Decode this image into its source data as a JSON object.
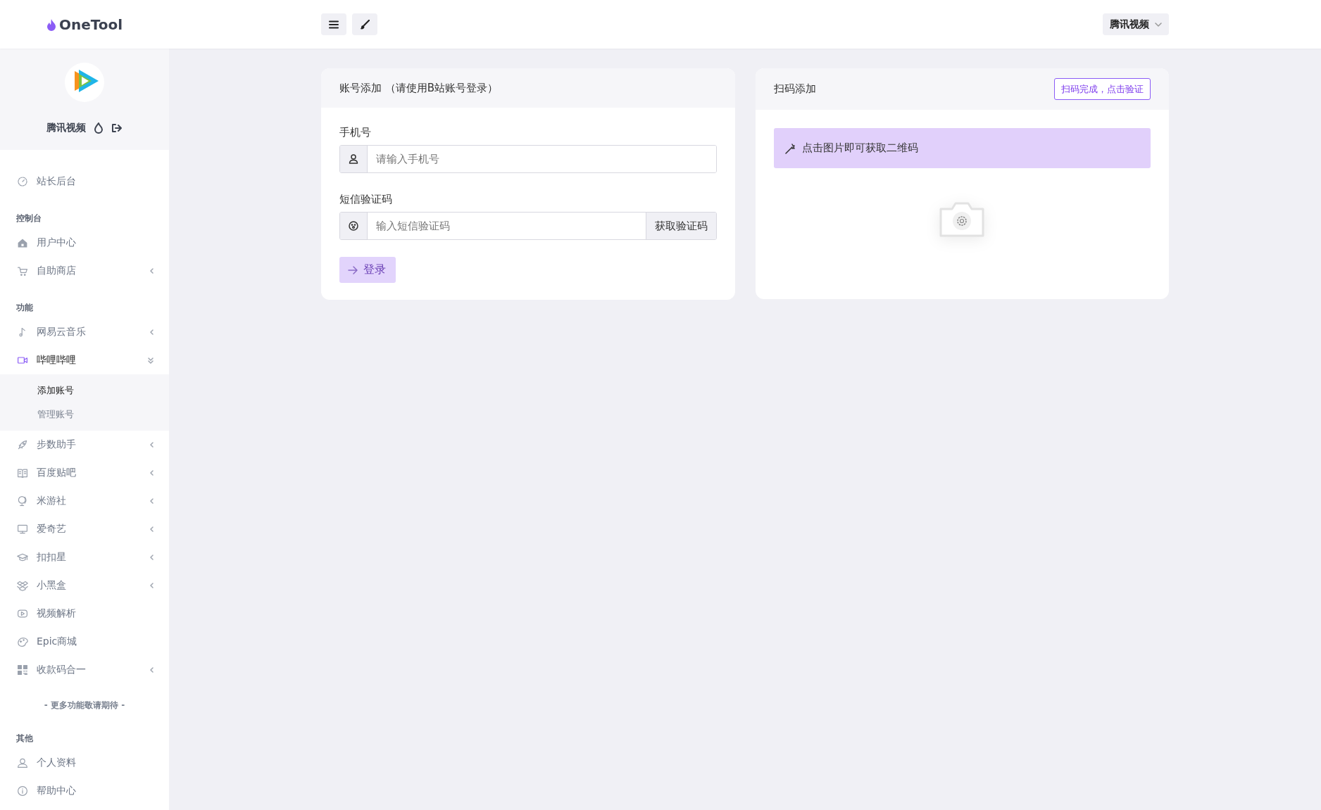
{
  "header": {
    "logo": "OneTool",
    "tool_buttons": [
      {
        "kind": "menu"
      },
      {
        "kind": "brush"
      }
    ],
    "site_switch": "腾讯视频"
  },
  "sidebar": {
    "profile": {
      "name": "腾讯视频"
    },
    "menu": [
      {
        "kind": "link",
        "label": "站长后台",
        "has_submenu": false
      },
      {
        "kind": "heading",
        "label": "控制台"
      },
      {
        "kind": "link",
        "label": "用户中心",
        "has_submenu": false
      },
      {
        "kind": "link",
        "label": "自助商店",
        "has_submenu": true,
        "expanded": false
      },
      {
        "kind": "heading",
        "label": "功能"
      },
      {
        "kind": "link",
        "label": "网易云音乐",
        "has_submenu": true,
        "expanded": false
      },
      {
        "kind": "link",
        "label": "哔哩哔哩",
        "has_submenu": true,
        "expanded": true,
        "children": [
          {
            "label": "添加账号",
            "selected": true
          },
          {
            "label": "管理账号",
            "selected": false
          }
        ]
      },
      {
        "kind": "link",
        "label": "步数助手",
        "has_submenu": true,
        "expanded": false
      },
      {
        "kind": "link",
        "label": "百度贴吧",
        "has_submenu": true,
        "expanded": false
      },
      {
        "kind": "link",
        "label": "米游社",
        "has_submenu": true,
        "expanded": false
      },
      {
        "kind": "link",
        "label": "爱奇艺",
        "has_submenu": true,
        "expanded": false
      },
      {
        "kind": "link",
        "label": "扣扣星",
        "has_submenu": true,
        "expanded": false
      },
      {
        "kind": "link",
        "label": "小黑盒",
        "has_submenu": true,
        "expanded": false
      },
      {
        "kind": "link",
        "label": "视频解析",
        "has_submenu": false
      },
      {
        "kind": "link",
        "label": "Epic商城",
        "has_submenu": false
      },
      {
        "kind": "link",
        "label": "收款码合一",
        "has_submenu": true,
        "expanded": false
      },
      {
        "kind": "note",
        "label": "- 更多功能敬请期待 -"
      },
      {
        "kind": "heading",
        "label": "其他"
      },
      {
        "kind": "link",
        "label": "个人资料",
        "has_submenu": false
      },
      {
        "kind": "link",
        "label": "帮助中心",
        "has_submenu": false
      }
    ]
  },
  "account_card": {
    "title": "账号添加 （请使用B站账号登录）",
    "fields": [
      {
        "label": "手机号",
        "placeholder": "请输入手机号"
      },
      {
        "label": "短信验证码",
        "placeholder": "输入短信验证码",
        "action": "获取验证码"
      }
    ],
    "submit": "登录"
  },
  "qr_card": {
    "title": "扫码添加",
    "verify_button": "扫码完成，点击验证",
    "hint": "点击图片即可获取二维码"
  }
}
